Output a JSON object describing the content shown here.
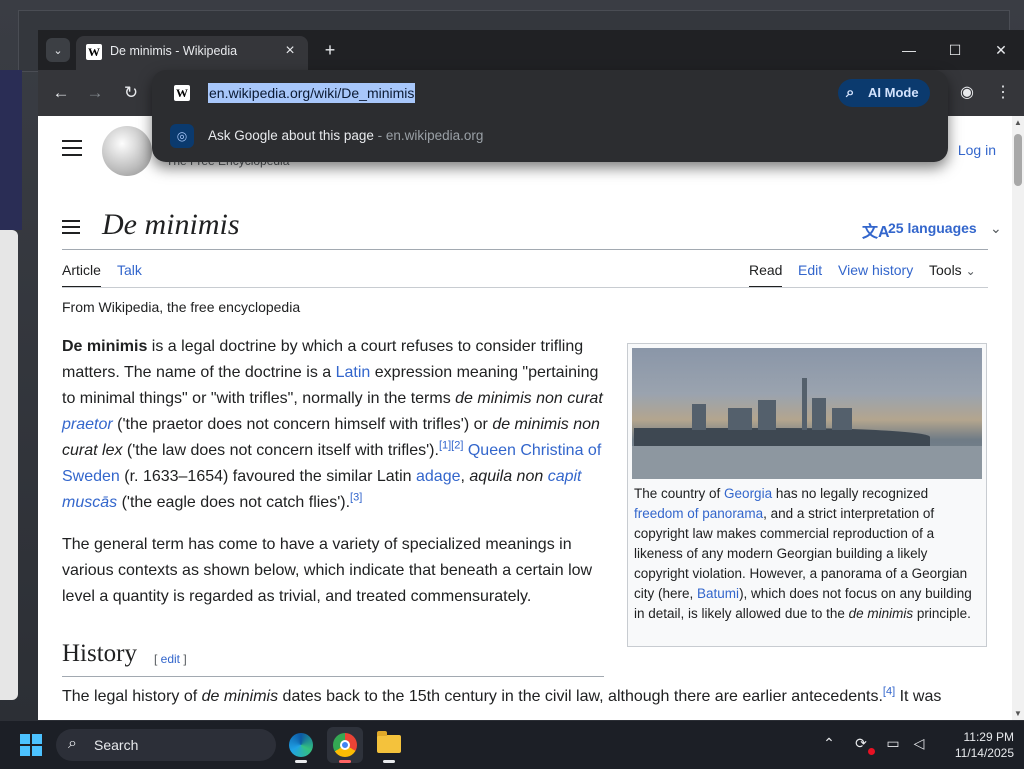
{
  "browser": {
    "tab_title": "De minimis - Wikipedia",
    "favicon_letter": "W",
    "url": "en.wikipedia.org/wiki/De_minimis",
    "ai_mode_label": "AI Mode",
    "suggestion_label": "Ask Google about this page",
    "suggestion_sep": " - ",
    "suggestion_domain": "en.wikipedia.org"
  },
  "page": {
    "tagline": "The Free Encyclopedia",
    "login": "Log in",
    "title": "De minimis",
    "languages": "25 languages",
    "tabs": {
      "article": "Article",
      "talk": "Talk",
      "read": "Read",
      "edit": "Edit",
      "view_history": "View history",
      "tools": "Tools"
    },
    "from_line": "From Wikipedia, the free encyclopedia",
    "p1": {
      "b": "De minimis",
      "t1": " is a legal doctrine by which a court refuses to consider trifling matters. The name of the doctrine is a ",
      "latin": "Latin",
      "t2": " expression meaning \"pertaining to minimal things\" or \"with trifles\", normally in the terms ",
      "i1": "de minimis non curat ",
      "praetor": "praetor",
      "t3": " ('the praetor does not concern himself with trifles') or ",
      "i2": "de minimis non curat lex",
      "t4": " ('the law does not concern itself with trifles').",
      "ref12": "[1][2]",
      "queen": "Queen Christina of Sweden",
      "t5": " (r. 1633–1654) favoured the similar Latin ",
      "adage": "adage",
      "t6": ", ",
      "i3": "aquila non ",
      "capit": "capit",
      "musc": "muscās",
      "t7": " ('the eagle does not catch flies').",
      "ref3": "[3]"
    },
    "p2": "The general term has come to have a variety of specialized meanings in various contexts as shown below, which indicate that beneath a certain low level a quantity is regarded as trivial, and treated commensurately.",
    "history": {
      "heading": "History",
      "edit_open": "[ ",
      "edit": "edit",
      "edit_close": " ]"
    },
    "p3": {
      "t1": "The legal history of ",
      "i1": "de minimis",
      "t2": " dates back to the 15th century in the civil law, although there are earlier antecedents.",
      "ref4": "[4]",
      "t3": " It was"
    },
    "infobox": {
      "c1": "The country of ",
      "georgia": "Georgia",
      "c2": " has no legally recognized ",
      "fop": "freedom of panorama",
      "c3": ", and a strict interpretation of copyright law makes commercial reproduction of a likeness of any modern Georgian building a likely copyright violation. However, a panorama of a Georgian city (here, ",
      "batumi": "Batumi",
      "c4": "), which does not focus on any building in detail, is likely allowed due to the ",
      "i1": "de minimis",
      "c5": " principle."
    }
  },
  "taskbar": {
    "search_label": "Search",
    "time": "11:29 PM",
    "date": "11/14/2025"
  }
}
